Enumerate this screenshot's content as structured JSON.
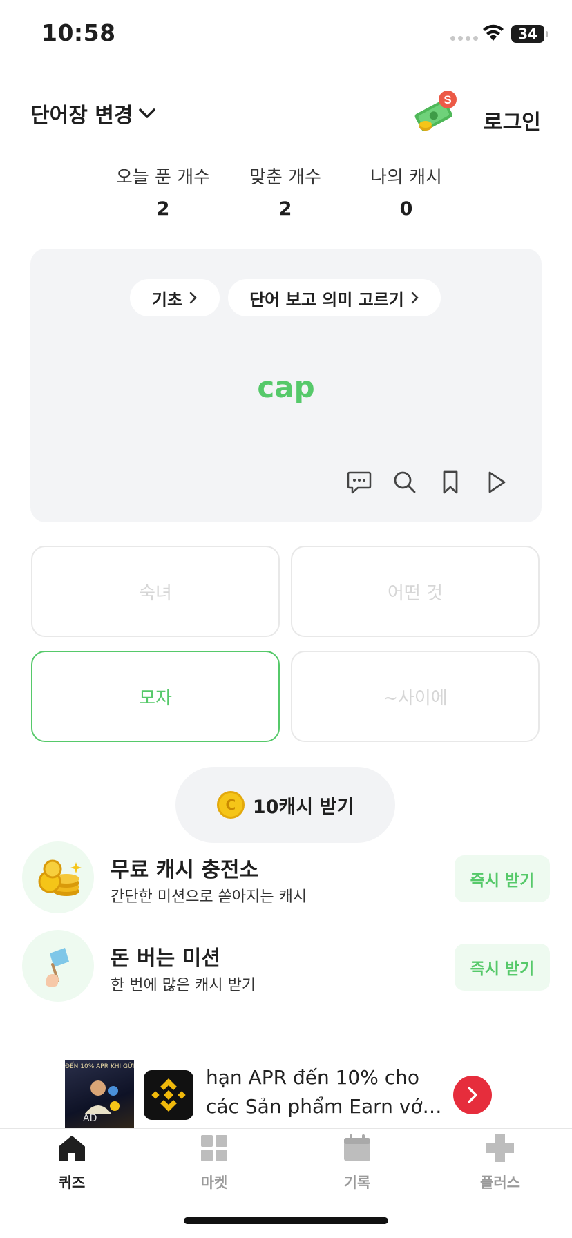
{
  "status_bar": {
    "time": "10:58",
    "battery": "34"
  },
  "header": {
    "vocab_change": "단어장 변경",
    "cash_badge": "S",
    "login": "로그인"
  },
  "stats": [
    {
      "label": "오늘 푼 개수",
      "value": "2"
    },
    {
      "label": "맞춘 개수",
      "value": "2"
    },
    {
      "label": "나의 캐시",
      "value": "0"
    }
  ],
  "quiz": {
    "level_chip": "기초",
    "mode_chip": "단어 보고 의미 고르기",
    "word": "cap",
    "icons": [
      "comment-icon",
      "search-icon",
      "bookmark-icon",
      "play-icon"
    ],
    "options": [
      "숙녀",
      "어떤 것",
      "모자",
      "~사이에"
    ],
    "selected_index": 2
  },
  "reward": {
    "label": "10캐시 받기",
    "coin_symbol": "C"
  },
  "missions": [
    {
      "title": "무료 캐시 충전소",
      "subtitle": "간단한 미션으로 쏟아지는 캐시",
      "button": "즉시 받기",
      "icon": "coins-icon"
    },
    {
      "title": "돈 버는 미션",
      "subtitle": "한 번에 많은 캐시 받기",
      "button": "즉시 받기",
      "icon": "flag-icon"
    }
  ],
  "ad": {
    "image_banner": "ĐẾN 10% APR KHI GỬI",
    "image_label": "AD",
    "line1": "hạn APR đến 10% cho",
    "line2": "các Sản phẩm Earn vớ…"
  },
  "tabs": [
    {
      "label": "퀴즈",
      "icon": "home-icon",
      "active": true
    },
    {
      "label": "마켓",
      "icon": "grid-icon",
      "active": false
    },
    {
      "label": "기록",
      "icon": "calendar-icon",
      "active": false
    },
    {
      "label": "플러스",
      "icon": "plus-icon",
      "active": false
    }
  ],
  "colors": {
    "accent": "#56c96a",
    "card_bg": "#f3f4f6",
    "ad_button": "#e62d3c"
  }
}
